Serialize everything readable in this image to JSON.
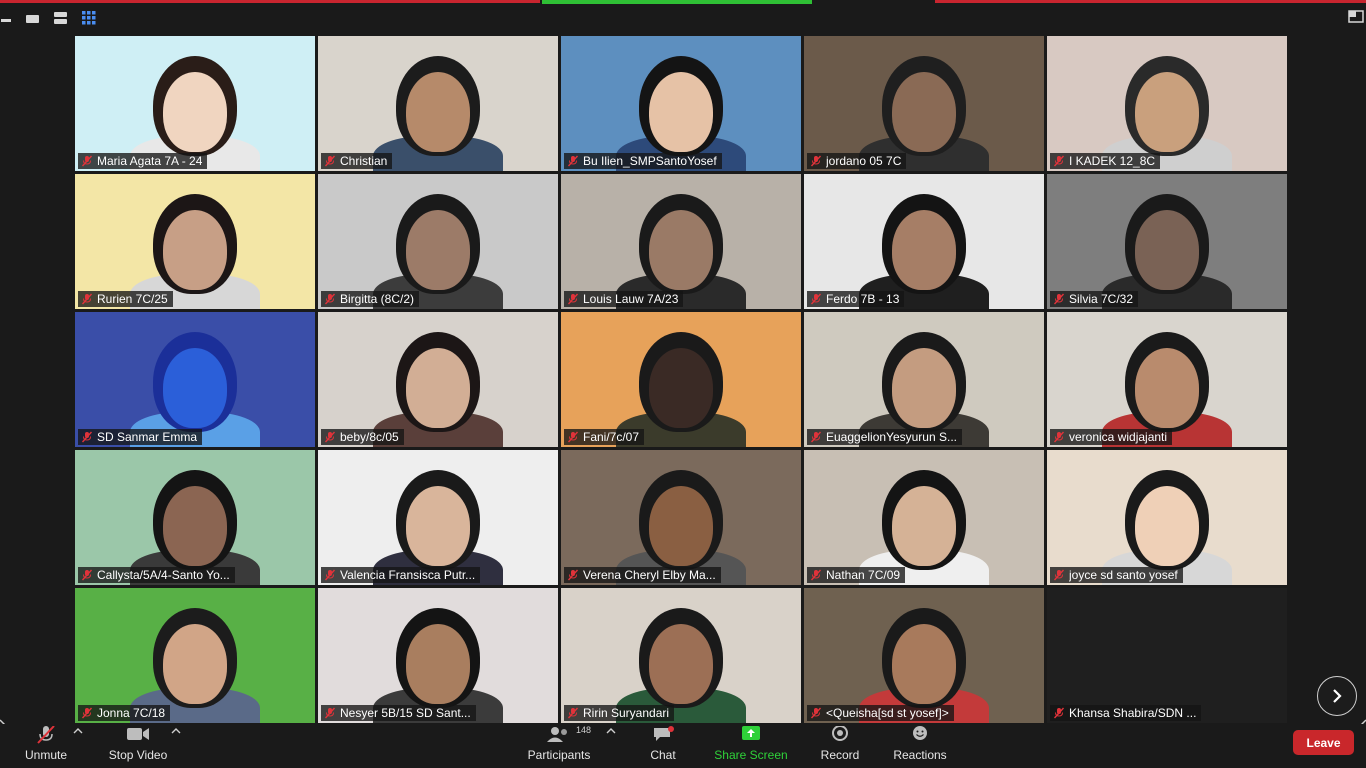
{
  "colors": {
    "background": "#1a1a1a",
    "leave": "#c9272b",
    "share_screen": "#2fd139",
    "muted_icon": "#e0333a",
    "active_speaker_bar": "#2fbf35"
  },
  "top_bar": {
    "icons": [
      "minimize-icon",
      "speaker-view-icon",
      "filmstrip-icon",
      "gallery-view-icon",
      "fullscreen-icon"
    ]
  },
  "participants": [
    "Maria Agata 7A - 24",
    "Christian",
    "Bu Ilien_SMPSantoYosef",
    "jordano 05 7C",
    "I KADEK 12_8C",
    "Rurien 7C/25",
    "Birgitta (8C/2)",
    "Louis Lauw 7A/23",
    "Ferdo 7B - 13",
    "Silvia 7C/32",
    "SD Sanmar Emma",
    "beby/8c/05",
    "Fani/7c/07",
    "EuaggelionYesyurun S...",
    "veronica widjajanti",
    "Callysta/5A/4-Santo Yo...",
    "Valencia Fransisca Putr...",
    "Verena Cheryl Elby Ma...",
    "Nathan 7C/09",
    "joyce sd santo yosef",
    "Jonna 7C/18",
    "Nesyer 5B/15 SD Sant...",
    "Ririn Suryandari",
    "<Queisha[sd st yosef]>",
    "Khansa Shabira/SDN ..."
  ],
  "toolbar": {
    "unmute": "Unmute",
    "stop_video": "Stop Video",
    "participants": "Participants",
    "participants_count": "148",
    "chat": "Chat",
    "share_screen": "Share Screen",
    "record": "Record",
    "reactions": "Reactions",
    "leave": "Leave"
  }
}
